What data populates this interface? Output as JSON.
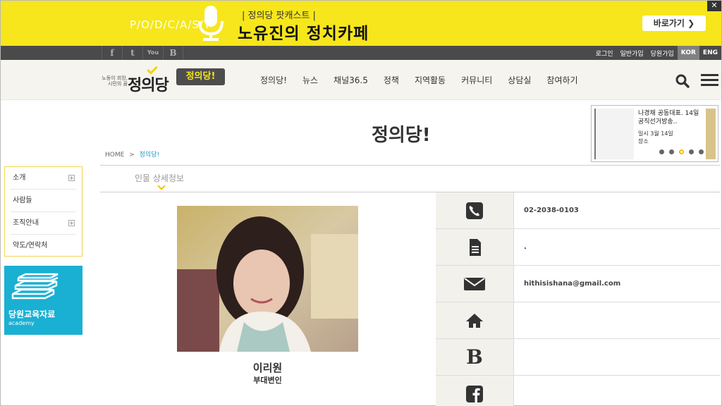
{
  "banner": {
    "podcast_text": "P/O/D/C/A/S/T",
    "subtitle": "| 정의당 팟캐스트 |",
    "title": "노유진의 정치카페",
    "goto_label": "바로가기 ❯",
    "close_label": "✕"
  },
  "utility": {
    "social": [
      {
        "icon": "facebook-icon",
        "glyph": "f"
      },
      {
        "icon": "twitter-icon",
        "glyph": "t"
      },
      {
        "icon": "youtube-icon",
        "glyph": "You"
      },
      {
        "icon": "blog-icon",
        "glyph": "B"
      }
    ],
    "links": [
      "로그인",
      "일반가입",
      "당원가입"
    ],
    "langs": [
      {
        "label": "KOR",
        "active": true
      },
      {
        "label": "ENG",
        "active": false
      }
    ]
  },
  "nav": {
    "logo_slogan": "노동이 희망, 시민의 꿈",
    "logo_name": "정의당",
    "badge": "정의당!",
    "menu": [
      "정의당!",
      "뉴스",
      "채널36.5",
      "정책",
      "지역활동",
      "커뮤니티",
      "상담실",
      "참여하기"
    ]
  },
  "page": {
    "title": "정의당!",
    "breadcrumb_home": "HOME",
    "breadcrumb_sep": ">",
    "breadcrumb_current": "정의당!",
    "section_tab": "인물 상세정보"
  },
  "news_widget": {
    "headline": "나경채 공동대표. 14일 공직선거방송..",
    "when_line1": "일시 3월 14일",
    "when_line2": "장소",
    "dots": 5,
    "active_dot": 2
  },
  "sidebar": {
    "items": [
      {
        "label": "소개",
        "expandable": true
      },
      {
        "label": "사람들",
        "expandable": false
      },
      {
        "label": "조직안내",
        "expandable": true
      },
      {
        "label": "약도/연락처",
        "expandable": false
      }
    ],
    "plus_glyph": "+",
    "academy_kor": "당원교육자료",
    "academy_eng": "academy"
  },
  "profile": {
    "name": "이리원",
    "role": "부대변인"
  },
  "contacts": [
    {
      "icon": "phone-icon",
      "value": "02-2038-0103"
    },
    {
      "icon": "document-icon",
      "value": "."
    },
    {
      "icon": "mail-icon",
      "value": "hithisishana@gmail.com"
    },
    {
      "icon": "home-icon",
      "value": ""
    },
    {
      "icon": "blog-b-icon",
      "value": ""
    },
    {
      "icon": "facebook-icon",
      "value": ""
    }
  ],
  "colors": {
    "banner_yellow": "#f6e61b",
    "accent_blue": "#1a9ac9",
    "academy_blue": "#1ab0d3",
    "dark_bar": "#4a4a4a"
  }
}
